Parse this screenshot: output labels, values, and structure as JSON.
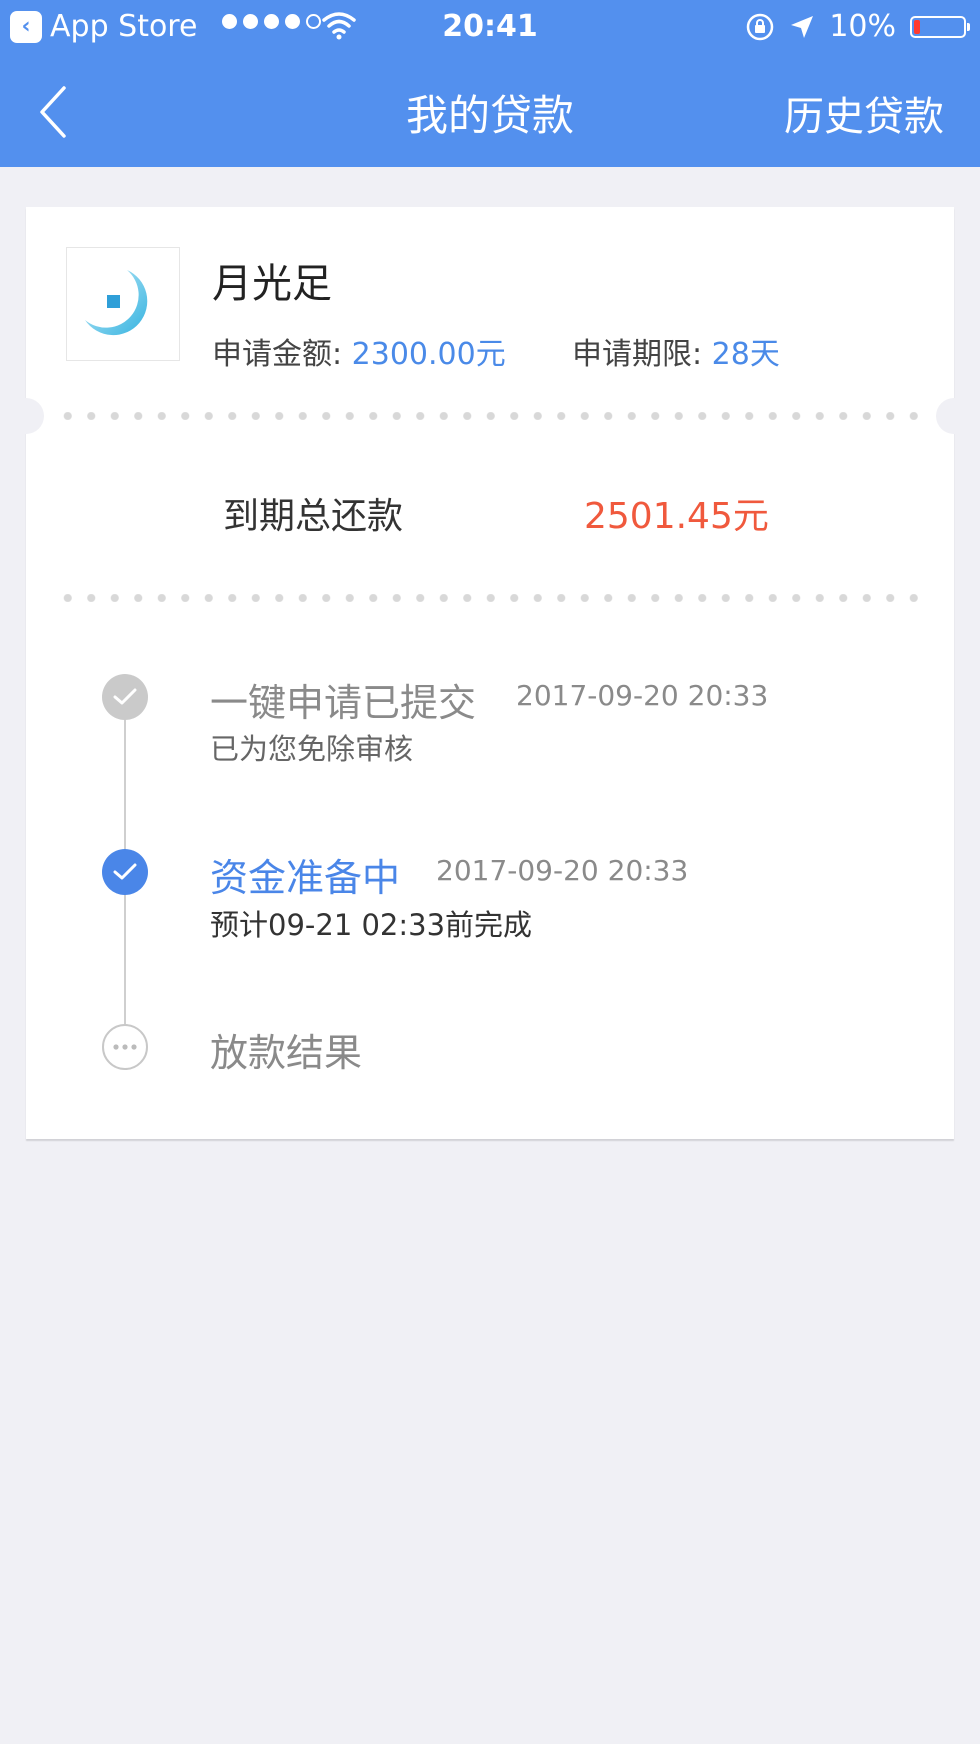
{
  "status_bar": {
    "back_app": "App Store",
    "time": "20:41",
    "battery": "10%",
    "battery_level": 0.1
  },
  "nav": {
    "title": "我的贷款",
    "right_action": "历史贷款"
  },
  "loan": {
    "product_name": "月光足",
    "amount_label": "申请金额: ",
    "amount_value": "2300.00元",
    "term_label": "申请期限: ",
    "term_value": "28天",
    "total_label": "到期总还款",
    "total_value": "2501.45元"
  },
  "steps": [
    {
      "title": "一键申请已提交",
      "time": "2017-09-20 20:33",
      "sub": "已为您免除审核",
      "state": "done"
    },
    {
      "title": "资金准备中",
      "time": "2017-09-20 20:33",
      "sub": "预计09-21 02:33前完成",
      "state": "active"
    },
    {
      "title": "放款结果",
      "time": "",
      "sub": "",
      "state": "pending"
    }
  ],
  "colors": {
    "primary": "#5390ee",
    "accent_blue": "#4a86e8",
    "highlight_red": "#f0593d",
    "background": "#f0f0f5"
  }
}
